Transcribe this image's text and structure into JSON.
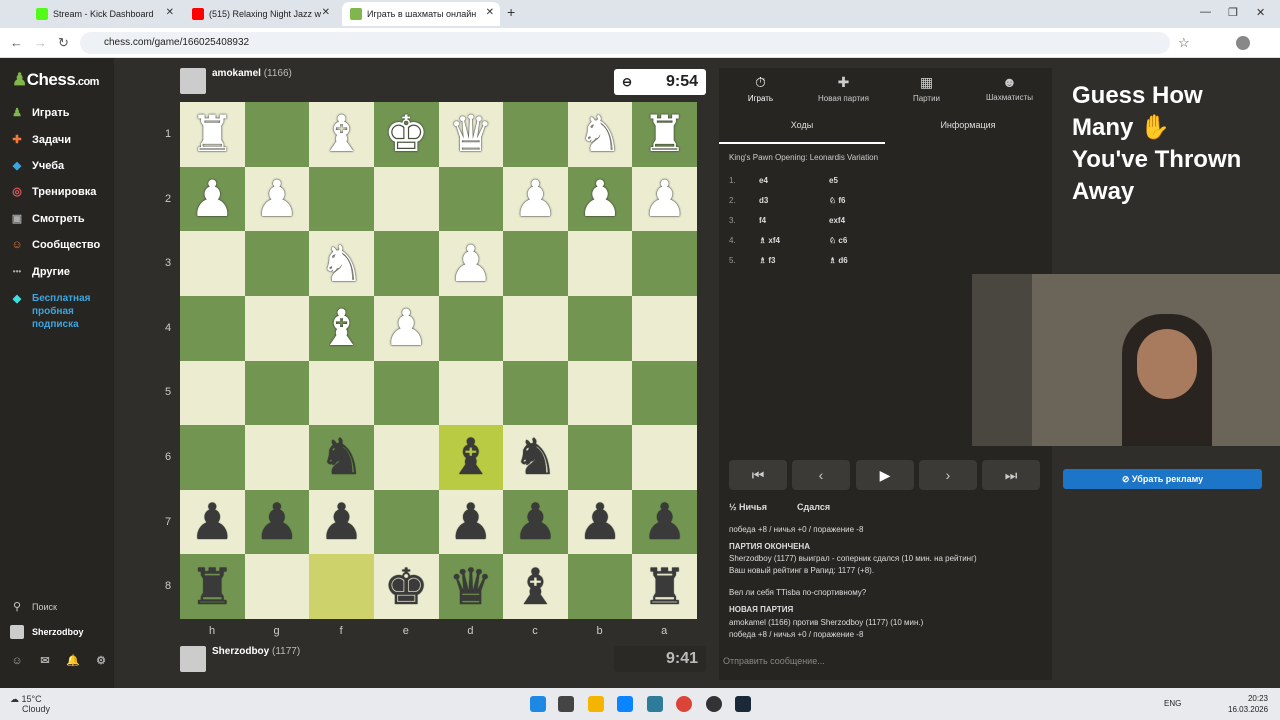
{
  "tabs": [
    {
      "title": "Stream - Kick Dashboard",
      "color": "#53fc18"
    },
    {
      "title": "(515) Relaxing Night Jazz w",
      "color": "#ff0000"
    },
    {
      "title": "Играть в шахматы онлайн",
      "color": "#81b64c"
    }
  ],
  "url": "chess.com/game/166025408932",
  "sidebar": {
    "logo_main": "Chess",
    "logo_suffix": ".com",
    "items": [
      {
        "label": "Играть",
        "icon": "♟"
      },
      {
        "label": "Задачи",
        "icon": "✚"
      },
      {
        "label": "Учеба",
        "icon": "◆"
      },
      {
        "label": "Тренировка",
        "icon": "◎"
      },
      {
        "label": "Смотреть",
        "icon": "▣"
      },
      {
        "label": "Сообщество",
        "icon": "☺"
      },
      {
        "label": "Другие",
        "icon": "•••"
      },
      {
        "label": "Бесплатная пробная подписка",
        "icon": "◆"
      }
    ],
    "search": "Поиск",
    "user": "Sherzodboy"
  },
  "top_player": {
    "name": "amokamel",
    "rating": "(1166)",
    "clock": "9:54"
  },
  "bottom_player": {
    "name": "Sherzodboy",
    "rating": "(1177)",
    "clock": "9:41"
  },
  "board": {
    "ranks": [
      "1",
      "2",
      "3",
      "4",
      "5",
      "6",
      "7",
      "8"
    ],
    "files": [
      "h",
      "g",
      "f",
      "e",
      "d",
      "c",
      "b",
      "a"
    ],
    "rows": [
      [
        "w:♜",
        "",
        "w:♝",
        "w:♚",
        "w:♛",
        "",
        "w:♞",
        "w:♜"
      ],
      [
        "w:♟",
        "w:♟",
        "",
        "",
        "",
        "w:♟",
        "w:♟",
        "w:♟"
      ],
      [
        "",
        "",
        "w:♞",
        "",
        "w:♟",
        "",
        "",
        ""
      ],
      [
        "",
        "",
        "w:♝",
        "w:♟",
        "",
        "",
        "",
        ""
      ],
      [
        "",
        "",
        "",
        "",
        "",
        "",
        "",
        ""
      ],
      [
        "",
        "",
        "b:♞",
        "",
        "b:♝",
        "b:♞",
        "",
        ""
      ],
      [
        "b:♟",
        "b:♟",
        "b:♟",
        "",
        "b:♟",
        "b:♟",
        "b:♟",
        "b:♟"
      ],
      [
        "b:♜",
        "",
        "",
        "b:♚",
        "b:♛",
        "b:♝",
        "",
        "b:♜"
      ]
    ]
  },
  "panel": {
    "tabs": [
      {
        "label": "Играть",
        "icon": "⏱"
      },
      {
        "label": "Новая партия",
        "icon": "✚"
      },
      {
        "label": "Партии",
        "icon": "▦"
      },
      {
        "label": "Шахматисты",
        "icon": "☻"
      }
    ],
    "subtabs": [
      "Ходы",
      "Информация"
    ],
    "opening": "King's Pawn Opening: Leonardis Variation",
    "moves": [
      {
        "n": "1.",
        "w": "e4",
        "b": "e5"
      },
      {
        "n": "2.",
        "w": "d3",
        "b": "♘ f6"
      },
      {
        "n": "3.",
        "w": "f4",
        "b": "exf4"
      },
      {
        "n": "4.",
        "w": "♗ xf4",
        "b": "♘ c6"
      },
      {
        "n": "5.",
        "w": "♗ f3",
        "b": "♗ d6"
      }
    ],
    "draw": "½ Ничья",
    "resign": "Сдался",
    "chat": [
      {
        "text": "победа +8 / ничья +0 / поражение -8",
        "h": false
      },
      {
        "text": "ПАРТИЯ ОКОНЧЕНА",
        "h": true
      },
      {
        "text": "Sherzodboy (1177) выиграл - соперник сдался (10 мин. на рейтинг)",
        "h": false
      },
      {
        "text": "Ваш новый рейтинг в Рапид: 1177 (+8).",
        "h": false
      },
      {
        "text": "Вел ли себя TTisba по-спортивному?",
        "h": false
      },
      {
        "text": "НОВАЯ ПАРТИЯ",
        "h": true
      },
      {
        "text": "amokamel (1166) против Sherzodboy (1177) (10 мин.)",
        "h": false
      },
      {
        "text": "победа +8 / ничья +0 / поражение -8",
        "h": false
      }
    ],
    "message_placeholder": "Отправить сообщение..."
  },
  "ad": {
    "text": "Guess How Many ✋ You've Thrown Away",
    "remove": "Убрать рекламу"
  },
  "taskbar": {
    "temp": "15°C",
    "weather": "Cloudy",
    "lang": "ENG",
    "time": "20:23",
    "date": "16.03.2026"
  }
}
